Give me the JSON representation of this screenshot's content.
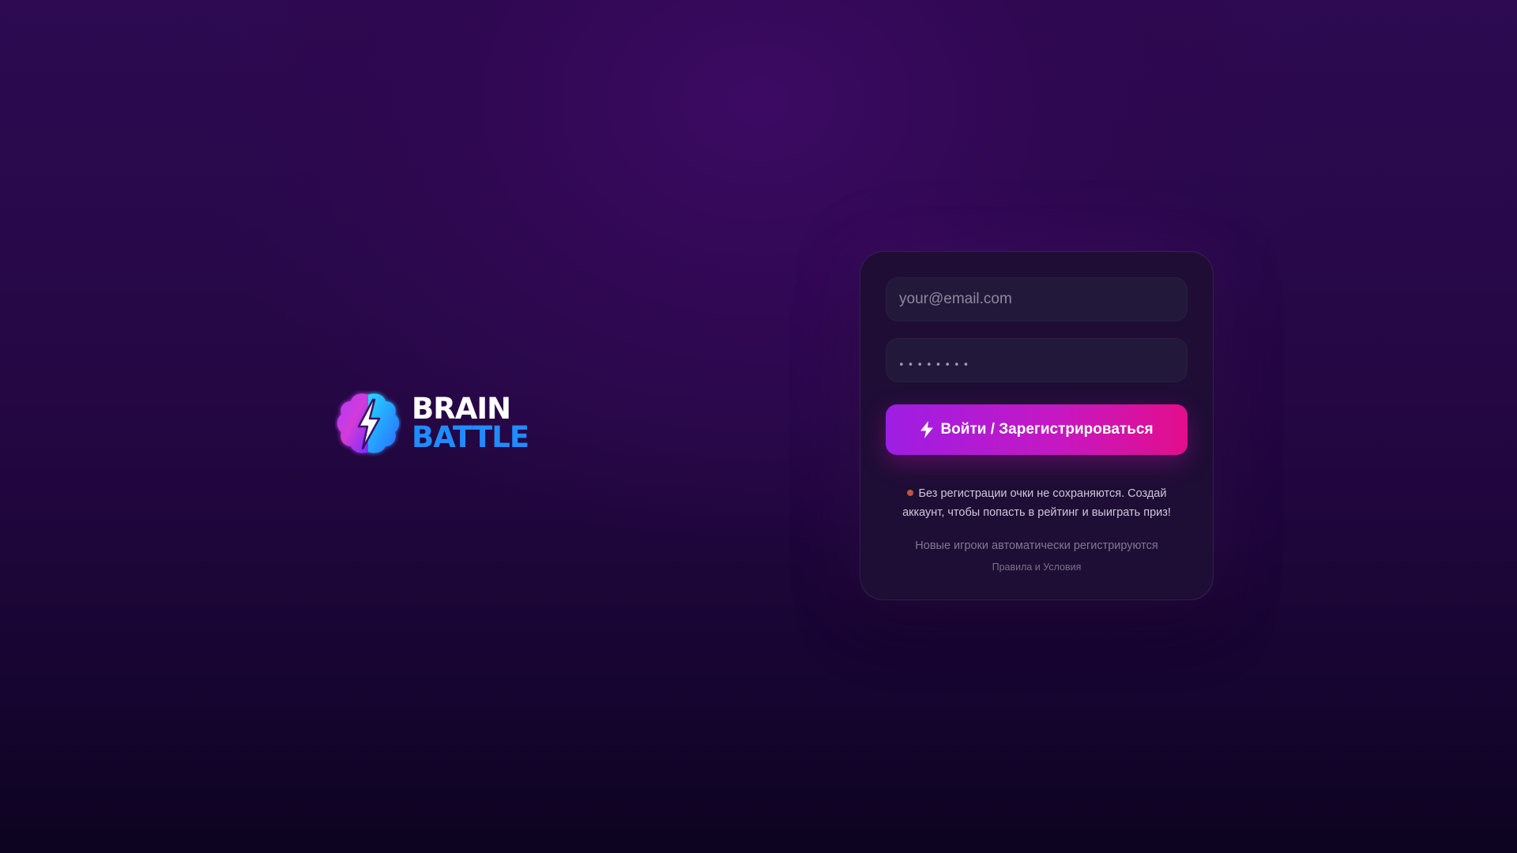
{
  "brand": {
    "line1": "BRAIN",
    "line2": "BATTLE",
    "icon": "brain-lightning-icon",
    "colors": {
      "line1": "#ffffff",
      "line2": "#1f8cff"
    }
  },
  "login": {
    "email_placeholder": "your@email.com",
    "password_placeholder": "••••••••",
    "submit_label": "Войти / Зарегистрироваться",
    "submit_icon": "lightning-icon",
    "notice": "Без регистрации очки не сохраняются. Создай аккаунт, чтобы попасть в рейтинг и выиграть приз!",
    "auto_register_note": "Новые игроки автоматически регистрируются",
    "terms_link": "Правила и Условия"
  },
  "colors": {
    "accent_start": "#9d1ee4",
    "accent_end": "#e30e8b",
    "notice_dot": "#c0553d"
  }
}
